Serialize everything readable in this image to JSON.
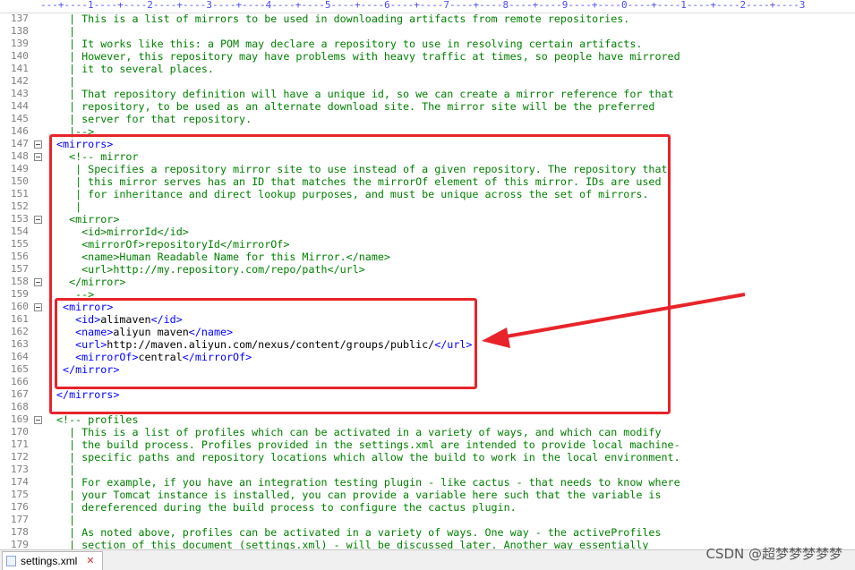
{
  "ruler": "---+----1----+----2----+----3----+----4----+----5----+----6----+----7----+----8----+----9----+----0----+----1----+----2----+----3",
  "lines": [
    {
      "n": "137",
      "fold": false,
      "parts": [
        {
          "c": "c",
          "t": "  | This is a list of mirrors to be used in downloading artifacts from remote repositories."
        }
      ]
    },
    {
      "n": "138",
      "fold": false,
      "parts": [
        {
          "c": "c",
          "t": "  |"
        }
      ]
    },
    {
      "n": "139",
      "fold": false,
      "parts": [
        {
          "c": "c",
          "t": "  | It works like this: a POM may declare a repository to use in resolving certain artifacts."
        }
      ]
    },
    {
      "n": "140",
      "fold": false,
      "parts": [
        {
          "c": "c",
          "t": "  | However, this repository may have problems with heavy traffic at times, so people have mirrored"
        }
      ]
    },
    {
      "n": "141",
      "fold": false,
      "parts": [
        {
          "c": "c",
          "t": "  | it to several places."
        }
      ]
    },
    {
      "n": "142",
      "fold": false,
      "parts": [
        {
          "c": "c",
          "t": "  |"
        }
      ]
    },
    {
      "n": "143",
      "fold": false,
      "parts": [
        {
          "c": "c",
          "t": "  | That repository definition will have a unique id, so we can create a mirror reference for that"
        }
      ]
    },
    {
      "n": "144",
      "fold": false,
      "parts": [
        {
          "c": "c",
          "t": "  | repository, to be used as an alternate download site. The mirror site will be the preferred"
        }
      ]
    },
    {
      "n": "145",
      "fold": false,
      "parts": [
        {
          "c": "c",
          "t": "  | server for that repository."
        }
      ]
    },
    {
      "n": "146",
      "fold": false,
      "parts": [
        {
          "c": "c",
          "t": "  |-->"
        }
      ]
    },
    {
      "n": "147",
      "fold": true,
      "parts": [
        {
          "c": "t",
          "t": "<mirrors>"
        }
      ]
    },
    {
      "n": "148",
      "fold": true,
      "parts": [
        {
          "c": "c",
          "t": "  <!-- mirror"
        }
      ]
    },
    {
      "n": "149",
      "fold": false,
      "parts": [
        {
          "c": "c",
          "t": "   | Specifies a repository mirror site to use instead of a given repository. The repository that"
        }
      ]
    },
    {
      "n": "150",
      "fold": false,
      "parts": [
        {
          "c": "c",
          "t": "   | this mirror serves has an ID that matches the mirrorOf element of this mirror. IDs are used"
        }
      ]
    },
    {
      "n": "151",
      "fold": false,
      "parts": [
        {
          "c": "c",
          "t": "   | for inheritance and direct lookup purposes, and must be unique across the set of mirrors."
        }
      ]
    },
    {
      "n": "152",
      "fold": false,
      "parts": [
        {
          "c": "c",
          "t": "   |"
        }
      ]
    },
    {
      "n": "153",
      "fold": true,
      "parts": [
        {
          "c": "c",
          "t": "  <mirror>"
        }
      ]
    },
    {
      "n": "154",
      "fold": false,
      "parts": [
        {
          "c": "c",
          "t": "    <id>mirrorId</id>"
        }
      ]
    },
    {
      "n": "155",
      "fold": false,
      "parts": [
        {
          "c": "c",
          "t": "    <mirrorOf>repositoryId</mirrorOf>"
        }
      ]
    },
    {
      "n": "156",
      "fold": false,
      "parts": [
        {
          "c": "c",
          "t": "    <name>Human Readable Name for this Mirror.</name>"
        }
      ]
    },
    {
      "n": "157",
      "fold": false,
      "parts": [
        {
          "c": "c",
          "t": "    <url>http://my.repository.com/repo/path</url>"
        }
      ]
    },
    {
      "n": "158",
      "fold": true,
      "parts": [
        {
          "c": "c",
          "t": "  </mirror>"
        }
      ]
    },
    {
      "n": "159",
      "fold": false,
      "parts": [
        {
          "c": "c",
          "t": "   -->"
        }
      ]
    },
    {
      "n": "160",
      "fold": true,
      "parts": [
        {
          "c": "t",
          "t": " <mirror>"
        }
      ]
    },
    {
      "n": "161",
      "fold": false,
      "parts": [
        {
          "c": "t",
          "t": "   <id>"
        },
        {
          "c": "x",
          "t": "alimaven"
        },
        {
          "c": "t",
          "t": "</id>"
        }
      ]
    },
    {
      "n": "162",
      "fold": false,
      "parts": [
        {
          "c": "t",
          "t": "   <name>"
        },
        {
          "c": "x",
          "t": "aliyun maven"
        },
        {
          "c": "t",
          "t": "</name>"
        }
      ]
    },
    {
      "n": "163",
      "fold": false,
      "parts": [
        {
          "c": "t",
          "t": "   <url>"
        },
        {
          "c": "x",
          "t": "http://maven.aliyun.com/nexus/content/groups/public/"
        },
        {
          "c": "t",
          "t": "</url>"
        }
      ]
    },
    {
      "n": "164",
      "fold": false,
      "parts": [
        {
          "c": "t",
          "t": "   <mirrorOf>"
        },
        {
          "c": "x",
          "t": "central"
        },
        {
          "c": "t",
          "t": "</mirrorOf>"
        }
      ]
    },
    {
      "n": "165",
      "fold": false,
      "parts": [
        {
          "c": "t",
          "t": " </mirror>"
        }
      ]
    },
    {
      "n": "166",
      "fold": false,
      "parts": [
        {
          "c": "x",
          "t": ""
        }
      ]
    },
    {
      "n": "167",
      "fold": false,
      "parts": [
        {
          "c": "t",
          "t": "</mirrors>"
        }
      ]
    },
    {
      "n": "168",
      "fold": false,
      "parts": [
        {
          "c": "x",
          "t": ""
        }
      ]
    },
    {
      "n": "169",
      "fold": true,
      "parts": [
        {
          "c": "c",
          "t": "<!-- profiles"
        }
      ]
    },
    {
      "n": "170",
      "fold": false,
      "parts": [
        {
          "c": "c",
          "t": "  | This is a list of profiles which can be activated in a variety of ways, and which can modify"
        }
      ]
    },
    {
      "n": "171",
      "fold": false,
      "parts": [
        {
          "c": "c",
          "t": "  | the build process. Profiles provided in the settings.xml are intended to provide local machine-"
        }
      ]
    },
    {
      "n": "172",
      "fold": false,
      "parts": [
        {
          "c": "c",
          "t": "  | specific paths and repository locations which allow the build to work in the local environment."
        }
      ]
    },
    {
      "n": "173",
      "fold": false,
      "parts": [
        {
          "c": "c",
          "t": "  |"
        }
      ]
    },
    {
      "n": "174",
      "fold": false,
      "parts": [
        {
          "c": "c",
          "t": "  | For example, if you have an integration testing plugin - like cactus - that needs to know where"
        }
      ]
    },
    {
      "n": "175",
      "fold": false,
      "parts": [
        {
          "c": "c",
          "t": "  | your Tomcat instance is installed, you can provide a variable here such that the variable is"
        }
      ]
    },
    {
      "n": "176",
      "fold": false,
      "parts": [
        {
          "c": "c",
          "t": "  | dereferenced during the build process to configure the cactus plugin."
        }
      ]
    },
    {
      "n": "177",
      "fold": false,
      "parts": [
        {
          "c": "c",
          "t": "  |"
        }
      ]
    },
    {
      "n": "178",
      "fold": false,
      "parts": [
        {
          "c": "c",
          "t": "  | As noted above, profiles can be activated in a variety of ways. One way - the activeProfiles"
        }
      ]
    },
    {
      "n": "179",
      "fold": false,
      "parts": [
        {
          "c": "c",
          "t": "  | section of this document (settings.xml) - will be discussed later. Another way essentially"
        }
      ]
    }
  ],
  "tab": {
    "label": "settings.xml",
    "close": "✕"
  },
  "watermark": "CSDN @超梦梦梦梦梦",
  "colors": {
    "highlight": "#e8242a",
    "tag": "#0000ff",
    "comment": "#008000"
  }
}
